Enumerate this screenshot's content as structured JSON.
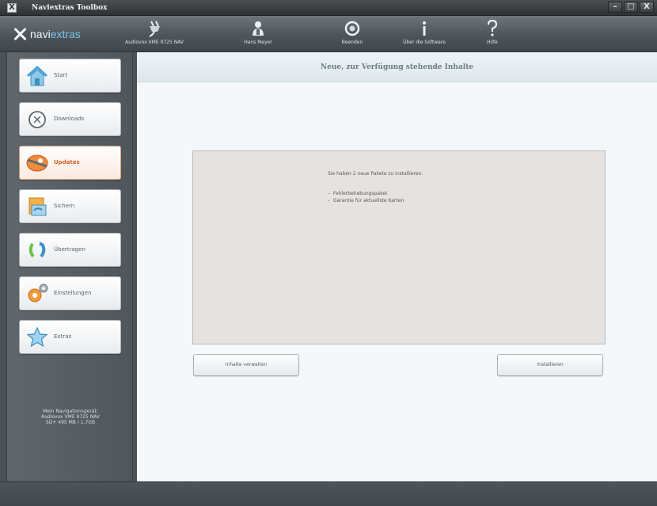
{
  "window": {
    "title": "Naviextras Toolbox",
    "logo_glyph": "X",
    "minimize": "–",
    "maximize": "□",
    "close": "X"
  },
  "toolbar": {
    "brand": {
      "prefix": "navi",
      "suffix": "extras"
    },
    "items": [
      {
        "label": "Audiovox VME 9725 NAV",
        "icon": "plug-icon"
      },
      {
        "label": "Hans Meyer",
        "icon": "user-icon"
      },
      {
        "label": "Beenden",
        "icon": "power-icon"
      },
      {
        "label": "Über die Software",
        "icon": "info-icon"
      },
      {
        "label": "Hilfe",
        "icon": "help-icon"
      }
    ]
  },
  "sidebar": {
    "items": [
      {
        "label": "Start",
        "icon": "home-icon",
        "active": false
      },
      {
        "label": "Downloads",
        "icon": "download-icon",
        "active": false
      },
      {
        "label": "Updates",
        "icon": "updates-icon",
        "active": true
      },
      {
        "label": "Sichern",
        "icon": "backup-icon",
        "active": false
      },
      {
        "label": "Übertragen",
        "icon": "transfer-icon",
        "active": false
      },
      {
        "label": "Einstellungen",
        "icon": "settings-icon",
        "active": false
      },
      {
        "label": "Extras",
        "icon": "star-icon",
        "active": false
      }
    ],
    "device_info": {
      "line1": "Mein Navigationsgerät:",
      "line2": "Audiovox VME 9725 NAV",
      "line3": "SD+ 495 MB / 1,7GB"
    }
  },
  "main": {
    "header": "Neue, zur Verfügung stehende Inhalte",
    "message": "Sie haben 2 neue Pakete zu installieren.",
    "packages": [
      "Fehlerbehebungspaket",
      "Garantie für aktuellste Karten"
    ],
    "manage_button": "Inhalte verwalten",
    "install_button": "Installieren"
  },
  "colors": {
    "accent": "#d0602a",
    "brand_highlight": "#7ec3e6",
    "panel_bg": "#e6e2e0"
  }
}
